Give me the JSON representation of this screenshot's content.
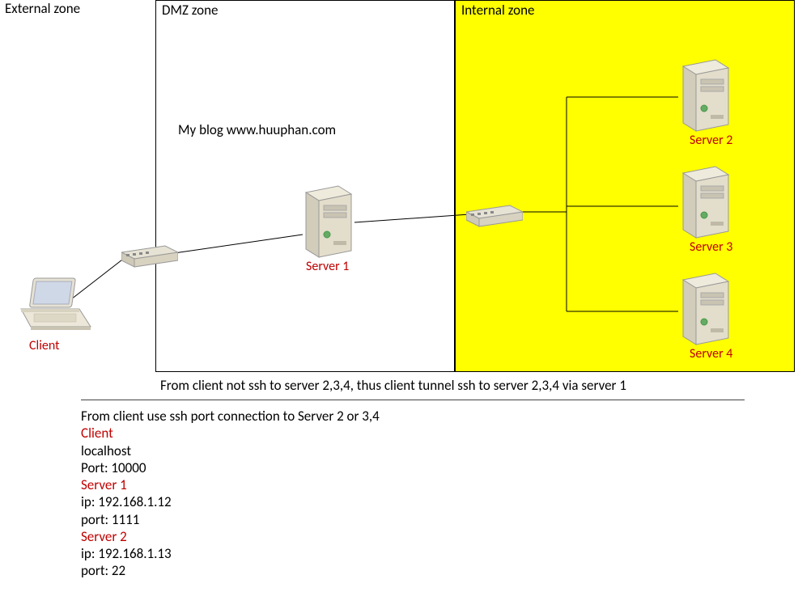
{
  "zones": {
    "external": {
      "label": "External zone"
    },
    "dmz": {
      "label": "DMZ zone"
    },
    "internal": {
      "label": "Internal zone"
    }
  },
  "blog_text": "My blog www.huuphan.com",
  "nodes": {
    "client": {
      "label": "Client"
    },
    "server1": {
      "label": "Server 1"
    },
    "server2": {
      "label": "Server 2"
    },
    "server3": {
      "label": "Server 3"
    },
    "server4": {
      "label": "Server 4"
    }
  },
  "caption": "From client not ssh to server 2,3,4, thus client tunnel ssh to server 2,3,4 via server 1",
  "details": {
    "heading": "From client use ssh port connection to Server 2 or 3,4",
    "client": {
      "name": "Client",
      "host_line": "localhost",
      "port_line": "Port: 10000"
    },
    "server1": {
      "name": "Server 1",
      "ip_line": "ip: 192.168.1.12",
      "port_line": "port: 1111"
    },
    "server2": {
      "name": "Server 2",
      "ip_line": "ip: 192.168.1.13",
      "port_line": "port: 22"
    }
  }
}
